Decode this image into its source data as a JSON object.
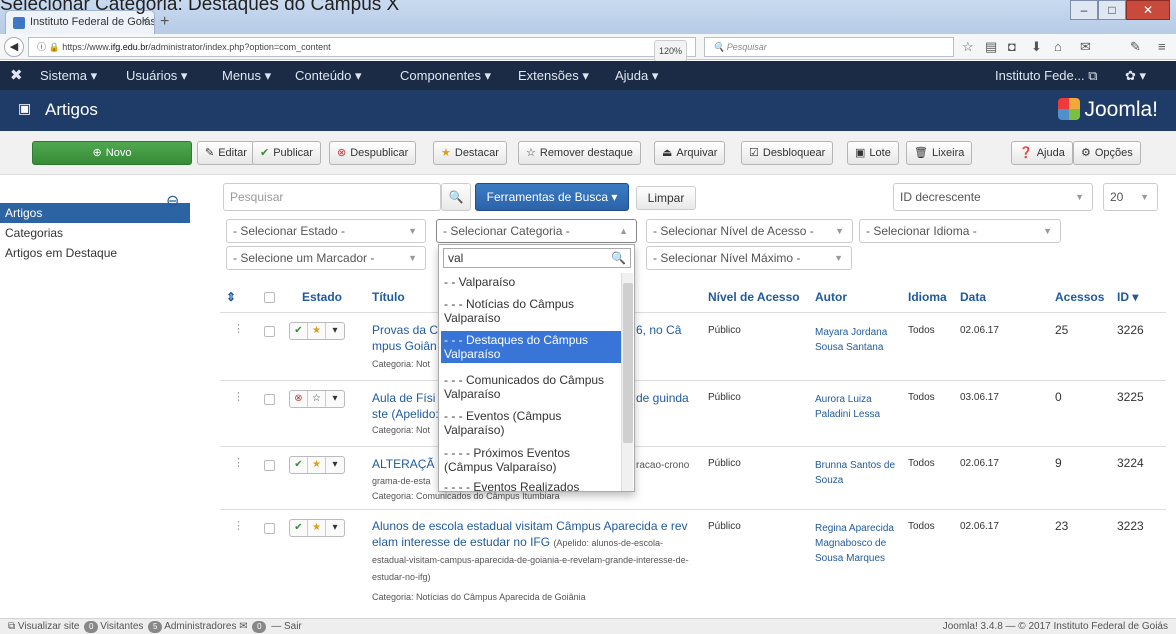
{
  "caption": "Selecionar Categoria: Destaques do Câmpus X",
  "browser": {
    "tab_title": "Instituto Federal de Goiás -...",
    "tab_close": "×",
    "new_tab": "+",
    "url_pre": "https://www.",
    "url_host": "ifg.edu.br",
    "url_path": "/administrator/index.php?option=com_content",
    "zoom": "120%",
    "search_placeholder": "Pesquisar"
  },
  "nav": {
    "menus": [
      "Sistema ▾",
      "Usuários ▾",
      "Menus ▾",
      "Conteúdo ▾",
      "Componentes ▾",
      "Extensões ▾",
      "Ajuda ▾"
    ],
    "site": "Instituto Fede... ⧉",
    "gear": "✿ ▾"
  },
  "header": {
    "title": "Artigos",
    "logo": "Joomla!"
  },
  "toolbar": {
    "new": "Novo",
    "edit": "Editar",
    "publish": "Publicar",
    "unpublish": "Despublicar",
    "feature": "Destacar",
    "unfeature": "Remover destaque",
    "archive": "Arquivar",
    "unlock": "Desbloquear",
    "batch": "Lote",
    "trash": "Lixeira",
    "help": "Ajuda",
    "options": "Opções"
  },
  "sidebar": {
    "items": [
      "Artigos",
      "Categorias",
      "Artigos em Destaque"
    ]
  },
  "filters": {
    "search_placeholder": "Pesquisar",
    "search_tools": "Ferramentas de Busca ▾",
    "clear": "Limpar",
    "order": "ID decrescente",
    "limit": "20",
    "state": "- Selecionar Estado -",
    "category": "- Selecionar Categoria -",
    "access": "- Selecionar Nível de Acesso -",
    "language": "- Selecionar Idioma -",
    "tag": "- Selecione um Marcador -",
    "max_level": "- Selecionar Nível Máximo -"
  },
  "dropdown": {
    "query": "val",
    "options": [
      "- - Valparaíso",
      "- - - Notícias do Câmpus Valparaíso",
      "- - - Destaques do Câmpus Valparaíso",
      "- - - Comunicados do Câmpus Valparaíso",
      "- - - Eventos (Câmpus Valparaíso)",
      "- - - - Próximos Eventos (Câmpus Valparaíso)",
      "- - - - Eventos Realizados"
    ],
    "highlighted": 2
  },
  "table": {
    "headers": {
      "sort": "⇕",
      "status": "Estado",
      "title": "Título",
      "access": "Nível de Acesso",
      "author": "Autor",
      "language": "Idioma",
      "date": "Data",
      "hits": "Acessos",
      "id": "ID ▾"
    },
    "rows": [
      {
        "title": "Provas da C",
        "title_tail": "6, no Câ",
        "title2": "mpus Goiân",
        "category": "Categoria: Not",
        "access": "Público",
        "author": "Mayara Jordana Sousa Santana",
        "language": "Todos",
        "date": "02.06.17",
        "hits": "25",
        "id": "3226"
      },
      {
        "title": "Aula de Físi",
        "title_tail": "de guinda",
        "title2": "ste (Apelido: a",
        "category": "Categoria: Not",
        "access": "Público",
        "author": "Aurora Luiza Paladini Lessa",
        "language": "Todos",
        "date": "03.06.17",
        "hits": "0",
        "id": "3225"
      },
      {
        "title": "ALTERAÇÃ",
        "title_tail": "racao-crono",
        "title2": "grama-de-esta",
        "category": "Categoria: Comunicados do Câmpus Itumbiara",
        "access": "Público",
        "author": "Brunna Santos de Souza",
        "language": "Todos",
        "date": "02.06.17",
        "hits": "9",
        "id": "3224"
      },
      {
        "title": "Alunos de escola estadual visitam Câmpus Aparecida e rev elam interesse de estudar no IFG",
        "alias": "(Apelido: alunos-de-escola-estadual-visitam-campus-aparecida-de-goiania-e-revelam-grande-interesse-de-estudar-no-ifg)",
        "category": "Categoria: Notícias do Câmpus Aparecida de Goiânia",
        "access": "Público",
        "author": "Regina Aparecida Magnabosco de Sousa Marques",
        "language": "Todos",
        "date": "02.06.17",
        "hits": "23",
        "id": "3223"
      }
    ]
  },
  "status": {
    "view_site": "Visualizar site",
    "visitors_count": "0",
    "visitors": "Visitantes",
    "admins_count": "5",
    "admins": "Administradores",
    "msg_count": "0",
    "logout": "Sair",
    "version": "Joomla! 3.4.8 — © 2017 Instituto Federal de Goiás"
  },
  "colors": {
    "nav": "#1b2b45",
    "title": "#1f3b68",
    "accent": "#2c63a3",
    "green": "#378c37"
  }
}
